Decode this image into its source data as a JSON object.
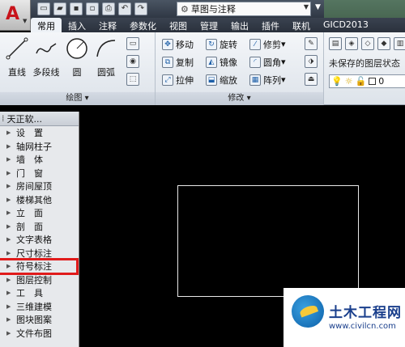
{
  "quick_access": {
    "workspace_value": "草图与注释"
  },
  "tabs": [
    "常用",
    "插入",
    "注释",
    "参数化",
    "视图",
    "管理",
    "输出",
    "插件",
    "联机",
    "GICD2013"
  ],
  "ribbon": {
    "draw": {
      "title": "绘图",
      "line": "直线",
      "polyline": "多段线",
      "circle": "圆",
      "arc": "圆弧"
    },
    "modify": {
      "title": "修改",
      "move": "移动",
      "rotate": "旋转",
      "trim": "修剪",
      "copy": "复制",
      "mirror": "镜像",
      "fillet": "圆角",
      "stretch": "拉伸",
      "scale": "缩放",
      "array": "阵列"
    },
    "layer": {
      "state": "未保存的图层状态",
      "current": "0"
    }
  },
  "palette": {
    "title": "天正软...",
    "items": [
      "设　置",
      "轴网柱子",
      "墙　体",
      "门　窗",
      "房间屋顶",
      "楼梯其他",
      "立　面",
      "剖　面",
      "文字表格",
      "尺寸标注",
      "符号标注",
      "图层控制",
      "工　具",
      "三维建模",
      "图块图案",
      "文件布图"
    ],
    "highlighted_index": 10,
    "highlight_color": "#e01b1b"
  },
  "watermark": {
    "name": "土木工程网",
    "url": "www.civilcn.com"
  }
}
